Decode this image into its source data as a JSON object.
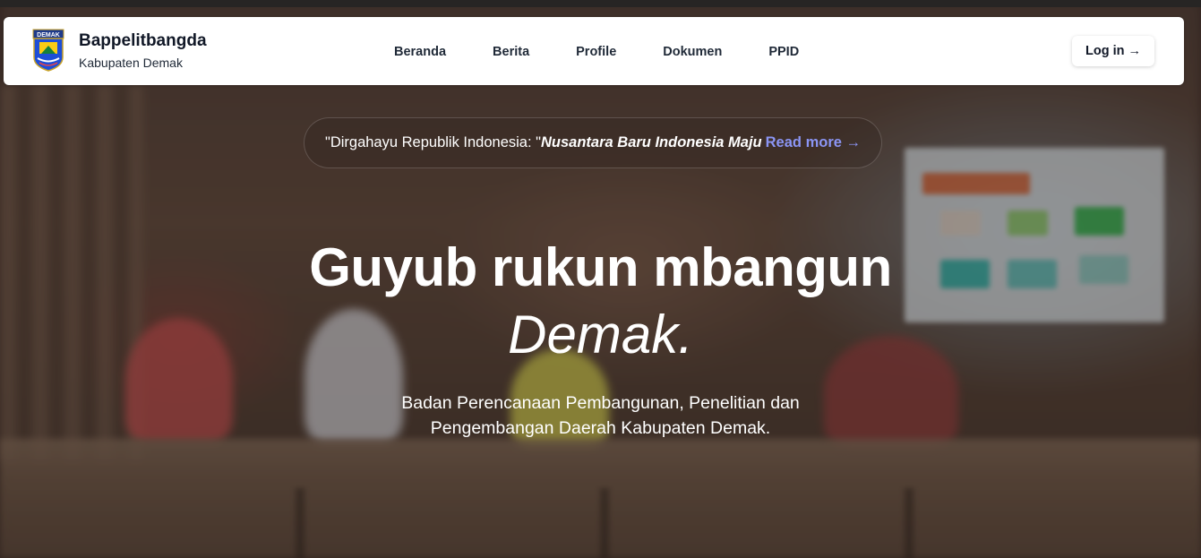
{
  "brand": {
    "title": "Bappelitbangda",
    "subtitle": "Kabupaten Demak",
    "logo_text": "DEMAK"
  },
  "nav": {
    "items": [
      {
        "label": "Beranda"
      },
      {
        "label": "Berita"
      },
      {
        "label": "Profile"
      },
      {
        "label": "Dokumen"
      },
      {
        "label": "PPID"
      }
    ],
    "login_label": "Log in →"
  },
  "announcement": {
    "prefix": "\"Dirgahayu Republik Indonesia: \"",
    "emphasis": "Nusantara Baru Indonesia Maju",
    "link": "Read more →"
  },
  "hero": {
    "headline": "Guyub rukun mbangun",
    "headline_emphasis": "Demak.",
    "subtext_line1": "Badan Perencanaan Pembangunan, Penelitian dan",
    "subtext_line2": "Pengembangan Daerah Kabupaten Demak."
  },
  "colors": {
    "accent_link": "#8b95f4",
    "navbar_bg": "#ffffff",
    "text_dark": "#111827"
  }
}
